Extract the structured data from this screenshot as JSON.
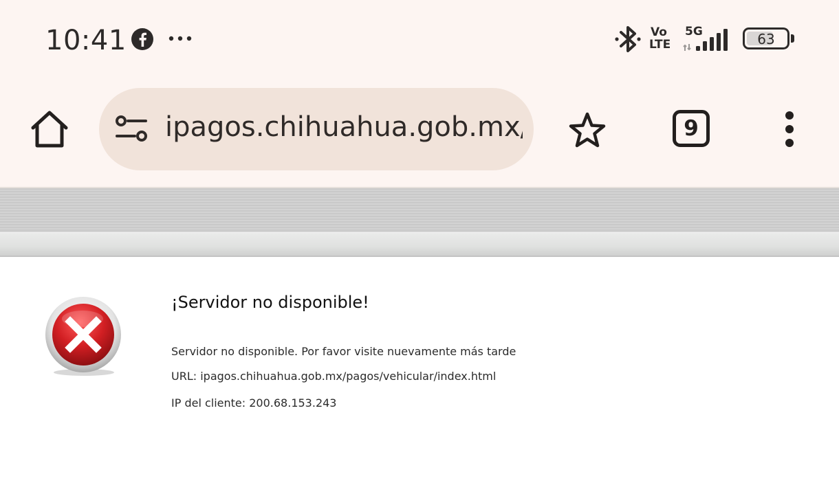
{
  "status_bar": {
    "time": "10:41",
    "notification_icons": [
      "facebook-icon",
      "more-dots-icon"
    ],
    "bluetooth_icon": "bluetooth-icon",
    "volte_line1": "Vo",
    "volte_line2": "LTE",
    "network": "5G",
    "battery_level": "63"
  },
  "browser_toolbar": {
    "home_icon": "home-icon",
    "site_settings_icon": "tune-icon",
    "url": "ipagos.chihuahua.gob.mx/p",
    "bookmark_icon": "star-icon",
    "tab_count": "9",
    "menu_icon": "more-vert-icon"
  },
  "page": {
    "error_icon": "error-x-icon",
    "title": "¡Servidor no disponible!",
    "message": "Servidor no disponible. Por favor visite nuevamente más tarde",
    "url_line": "URL: ipagos.chihuahua.gob.mx/pagos/vehicular/index.html",
    "client_ip_line": "IP del cliente: 200.68.153.243"
  },
  "colors": {
    "chrome_background": "#fdf5f2",
    "urlbar_background": "#f1e3da",
    "error_red": "#d21f23"
  }
}
